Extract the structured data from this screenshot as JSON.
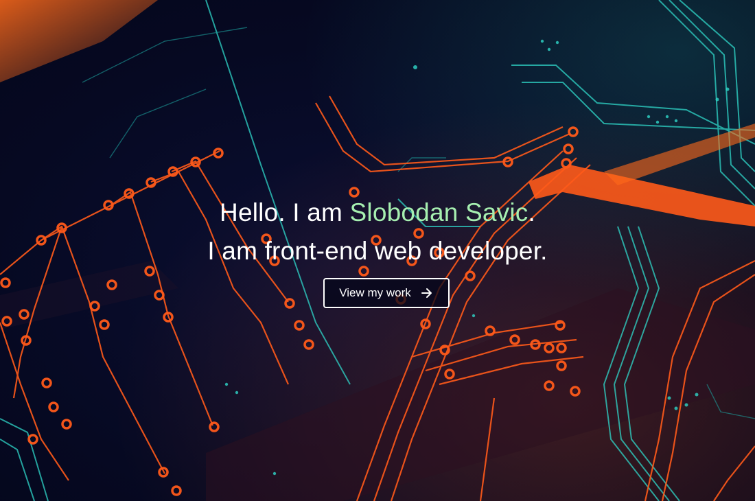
{
  "hero": {
    "greeting": "Hello. I am ",
    "name": "Slobodan Savic",
    "period": ".",
    "tagline": "I am front-end web developer.",
    "cta_label": "View my work",
    "cta_icon": "arrow-right-icon",
    "background": "circuit-board-image"
  },
  "colors": {
    "name_highlight": "#a6efb0",
    "text": "#ffffff",
    "trace_orange": "#ff5a1a",
    "trace_teal": "#2fd6c8",
    "background": "#070b24"
  }
}
